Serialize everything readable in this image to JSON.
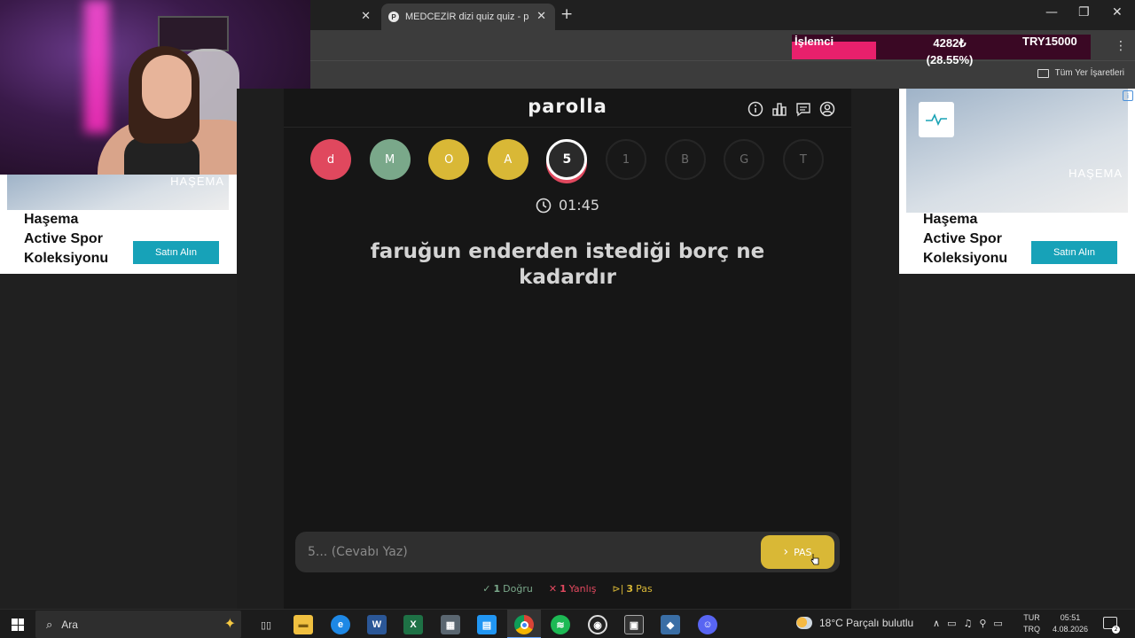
{
  "browser": {
    "tabs": [
      {
        "title": ""
      },
      {
        "title": "MEDCEZİR dizi quiz quiz - paro",
        "favicon": "P"
      }
    ],
    "bookmarks_label": "Tüm Yer İşaretleri"
  },
  "overlay": {
    "label": "İşlemci",
    "value": "4282₺",
    "percent": "(28.55%)",
    "target": "TRY15000",
    "progress_fraction": 0.2855,
    "bar_color": "#e8206c"
  },
  "ads": {
    "left": {
      "brand": "HAŞEMA",
      "title_lines": [
        "Haşema",
        "Active Spor",
        "Koleksiyonu"
      ],
      "button": "Satın Alın"
    },
    "right": {
      "brand": "HAŞEMA",
      "title_lines": [
        "Haşema",
        "Active Spor",
        "Koleksiyonu"
      ],
      "button": "Satın Alın",
      "info": "i"
    }
  },
  "game": {
    "logo": "parolla",
    "letters": [
      {
        "label": "d",
        "state": "wrong"
      },
      {
        "label": "M",
        "state": "correct"
      },
      {
        "label": "O",
        "state": "passed"
      },
      {
        "label": "A",
        "state": "passed"
      },
      {
        "label": "5",
        "state": "active"
      },
      {
        "label": "1",
        "state": "empty"
      },
      {
        "label": "B",
        "state": "empty"
      },
      {
        "label": "G",
        "state": "empty"
      },
      {
        "label": "T",
        "state": "empty"
      }
    ],
    "timer": "01:45",
    "question": "faruğun enderden istediği borç ne kadardır",
    "answer_placeholder": "5... (Cevabı Yaz)",
    "pass_button": "PAS",
    "stats": {
      "correct_count": "1",
      "correct_label": "Doğru",
      "wrong_count": "1",
      "wrong_label": "Yanlış",
      "pass_count": "3",
      "pass_label": "Pas"
    },
    "colors": {
      "correct": "#7aa88a",
      "wrong": "#e0485e",
      "passed": "#d9b836"
    }
  },
  "taskbar": {
    "search_placeholder": "Ara",
    "weather": "18°C  Parçalı bulutlu",
    "lang_top": "TUR",
    "lang_bottom": "TRQ",
    "time": "05:51",
    "date": "4.08.2026",
    "notification_count": "2"
  }
}
